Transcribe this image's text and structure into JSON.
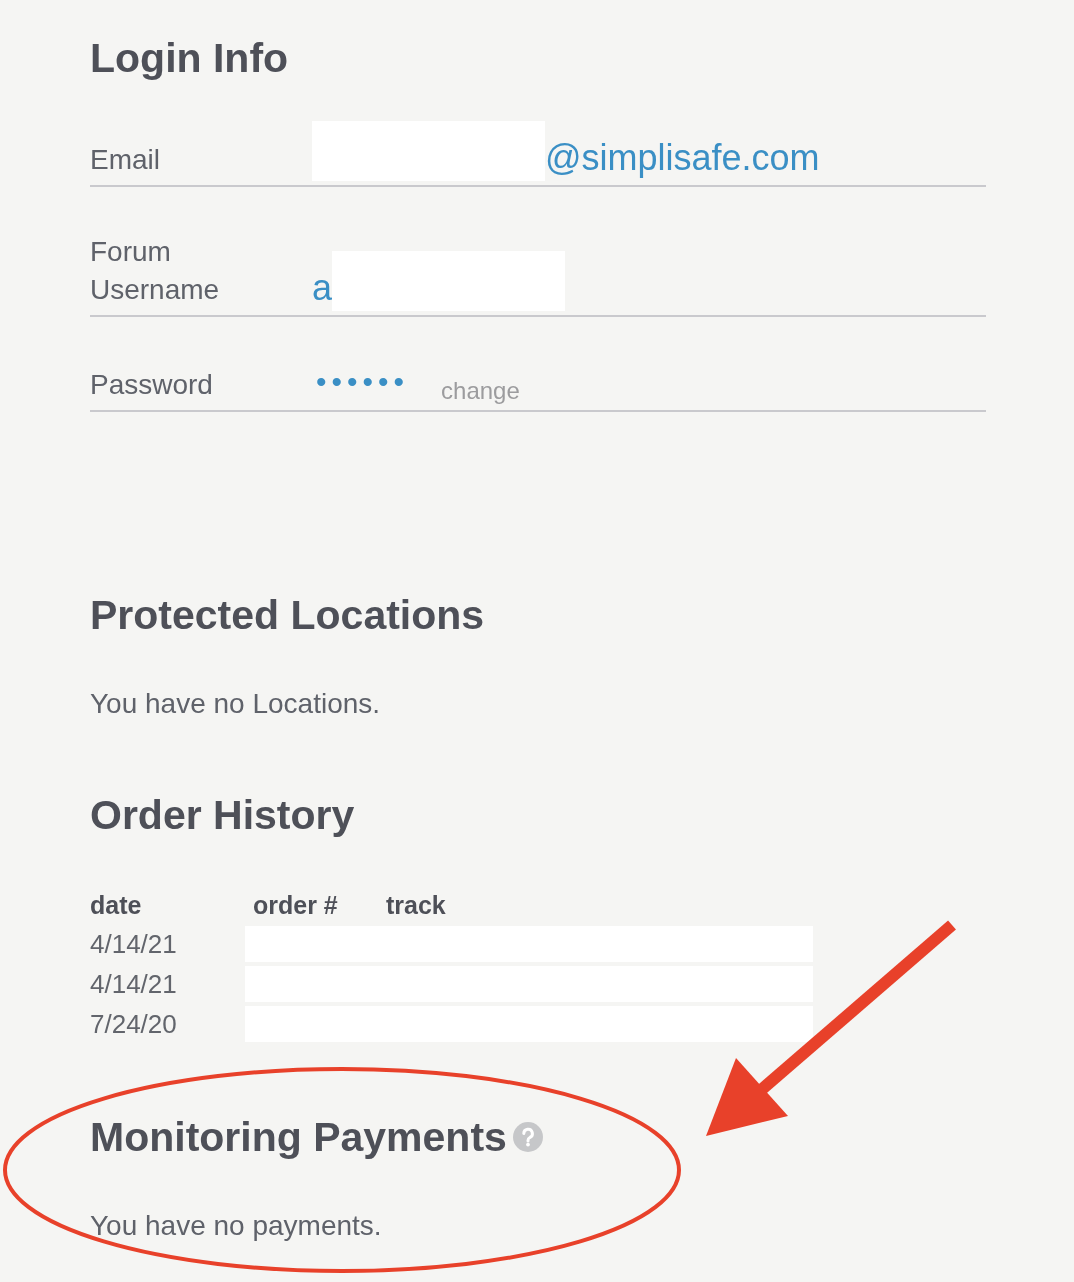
{
  "login_info": {
    "title": "Login Info",
    "fields": [
      {
        "label": "Email",
        "parts": [
          {
            "kind": "redaction"
          },
          {
            "kind": "text",
            "text": "@simplisafe.com"
          }
        ]
      },
      {
        "label": "Forum Username",
        "parts": [
          {
            "kind": "text",
            "text": "a"
          },
          {
            "kind": "redaction"
          }
        ]
      },
      {
        "label": "Password",
        "parts": [
          {
            "kind": "masked",
            "text": "••••••"
          }
        ],
        "action": "change"
      }
    ]
  },
  "protected_locations": {
    "title": "Protected Locations",
    "message": "You have no Locations."
  },
  "order_history": {
    "title": "Order History",
    "columns": [
      "date",
      "order #",
      "track"
    ],
    "rows": [
      {
        "date": "4/14/21",
        "redacted": true
      },
      {
        "date": "4/14/21",
        "redacted": true
      },
      {
        "date": "7/24/20",
        "redacted": true
      }
    ]
  },
  "monitoring_payments": {
    "title": "Monitoring Payments",
    "help": true,
    "message": "You have no payments."
  },
  "annotations": {
    "highlight_ellipse": true,
    "pointer_arrow": true
  }
}
